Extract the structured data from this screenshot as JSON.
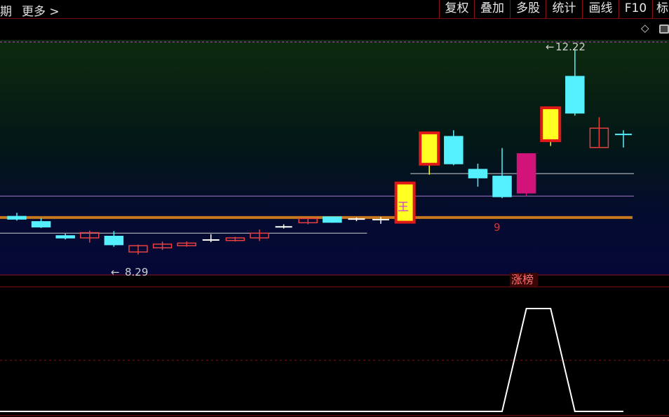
{
  "toolbar": {
    "left_items": [
      "期",
      "更多 >"
    ],
    "buttons": [
      "复权",
      "叠加",
      "多股",
      "统计",
      "画线",
      "F10",
      "标"
    ]
  },
  "icons": {
    "diamond": "◇",
    "window": "window-toggle-icon"
  },
  "colors": {
    "up_candle": "#e84040",
    "down_candle": "#54f0ff",
    "limit_up_fill": "#ffff22",
    "limit_up_border": "#e01818",
    "magenta_candle": "#d2147a",
    "ma_line": "#c8781c",
    "panel_border": "#8a1010",
    "indicator_line": "#ffffff"
  },
  "annotations": {
    "high_label": "12.22",
    "low_label": "8.29",
    "wang_mark": "王",
    "nine_mark": "9",
    "board_label": "涨榜"
  },
  "chart_data": {
    "type": "candlestick",
    "ylim": [
      7.9,
      12.4
    ],
    "candles": [
      {
        "o": 9.02,
        "h": 9.09,
        "l": 8.94,
        "c": 8.97,
        "kind": "down"
      },
      {
        "o": 8.92,
        "h": 8.99,
        "l": 8.8,
        "c": 8.82,
        "kind": "down"
      },
      {
        "o": 8.65,
        "h": 8.69,
        "l": 8.58,
        "c": 8.61,
        "kind": "down"
      },
      {
        "o": 8.61,
        "h": 8.75,
        "l": 8.52,
        "c": 8.71,
        "kind": "up"
      },
      {
        "o": 8.64,
        "h": 8.74,
        "l": 8.44,
        "c": 8.48,
        "kind": "down"
      },
      {
        "o": 8.34,
        "h": 8.48,
        "l": 8.29,
        "c": 8.46,
        "kind": "up"
      },
      {
        "o": 8.42,
        "h": 8.54,
        "l": 8.38,
        "c": 8.49,
        "kind": "up"
      },
      {
        "o": 8.46,
        "h": 8.54,
        "l": 8.44,
        "c": 8.51,
        "kind": "up"
      },
      {
        "o": 8.57,
        "h": 8.68,
        "l": 8.53,
        "c": 8.57,
        "kind": "doji"
      },
      {
        "o": 8.56,
        "h": 8.63,
        "l": 8.54,
        "c": 8.61,
        "kind": "up"
      },
      {
        "o": 8.61,
        "h": 8.77,
        "l": 8.55,
        "c": 8.7,
        "kind": "up"
      },
      {
        "o": 8.82,
        "h": 8.87,
        "l": 8.79,
        "c": 8.82,
        "kind": "doji"
      },
      {
        "o": 8.9,
        "h": 8.99,
        "l": 8.87,
        "c": 8.98,
        "kind": "up"
      },
      {
        "o": 9.01,
        "h": 9.02,
        "l": 8.9,
        "c": 8.91,
        "kind": "down"
      },
      {
        "o": 8.97,
        "h": 9.0,
        "l": 8.93,
        "c": 8.96,
        "kind": "doji"
      },
      {
        "o": 8.95,
        "h": 9.01,
        "l": 8.88,
        "c": 8.96,
        "kind": "doji"
      },
      {
        "o": 8.91,
        "h": 9.67,
        "l": 8.91,
        "c": 9.66,
        "kind": "limit"
      },
      {
        "o": 10.02,
        "h": 10.62,
        "l": 9.82,
        "c": 10.62,
        "kind": "limit"
      },
      {
        "o": 10.55,
        "h": 10.67,
        "l": 10.0,
        "c": 10.03,
        "kind": "down"
      },
      {
        "o": 9.92,
        "h": 10.03,
        "l": 9.59,
        "c": 9.76,
        "kind": "down"
      },
      {
        "o": 9.79,
        "h": 10.33,
        "l": 9.37,
        "c": 9.4,
        "kind": "down"
      },
      {
        "o": 9.47,
        "h": 10.22,
        "l": 9.41,
        "c": 10.22,
        "kind": "magenta"
      },
      {
        "o": 10.47,
        "h": 11.1,
        "l": 10.37,
        "c": 11.1,
        "kind": "limit"
      },
      {
        "o": 11.7,
        "h": 12.22,
        "l": 10.95,
        "c": 11.0,
        "kind": "down"
      },
      {
        "o": 10.34,
        "h": 10.92,
        "l": 10.34,
        "c": 10.71,
        "kind": "up"
      },
      {
        "o": 10.59,
        "h": 10.67,
        "l": 10.34,
        "c": 10.59,
        "kind": "cross"
      }
    ],
    "ma_level": 9.0,
    "hlines": [
      {
        "value": 8.7,
        "from": 0,
        "to": 14
      },
      {
        "value": 9.41,
        "from": 0,
        "to": 25
      },
      {
        "value": 9.84,
        "from": 17,
        "to": 25
      }
    ],
    "indicator": {
      "series": [
        0,
        0,
        0,
        0,
        0,
        0,
        0,
        0,
        0,
        0,
        0,
        0,
        0,
        0,
        0,
        0,
        0,
        0,
        0,
        0,
        0,
        1,
        1,
        0,
        0,
        0
      ],
      "ylim": [
        0,
        1
      ]
    }
  }
}
